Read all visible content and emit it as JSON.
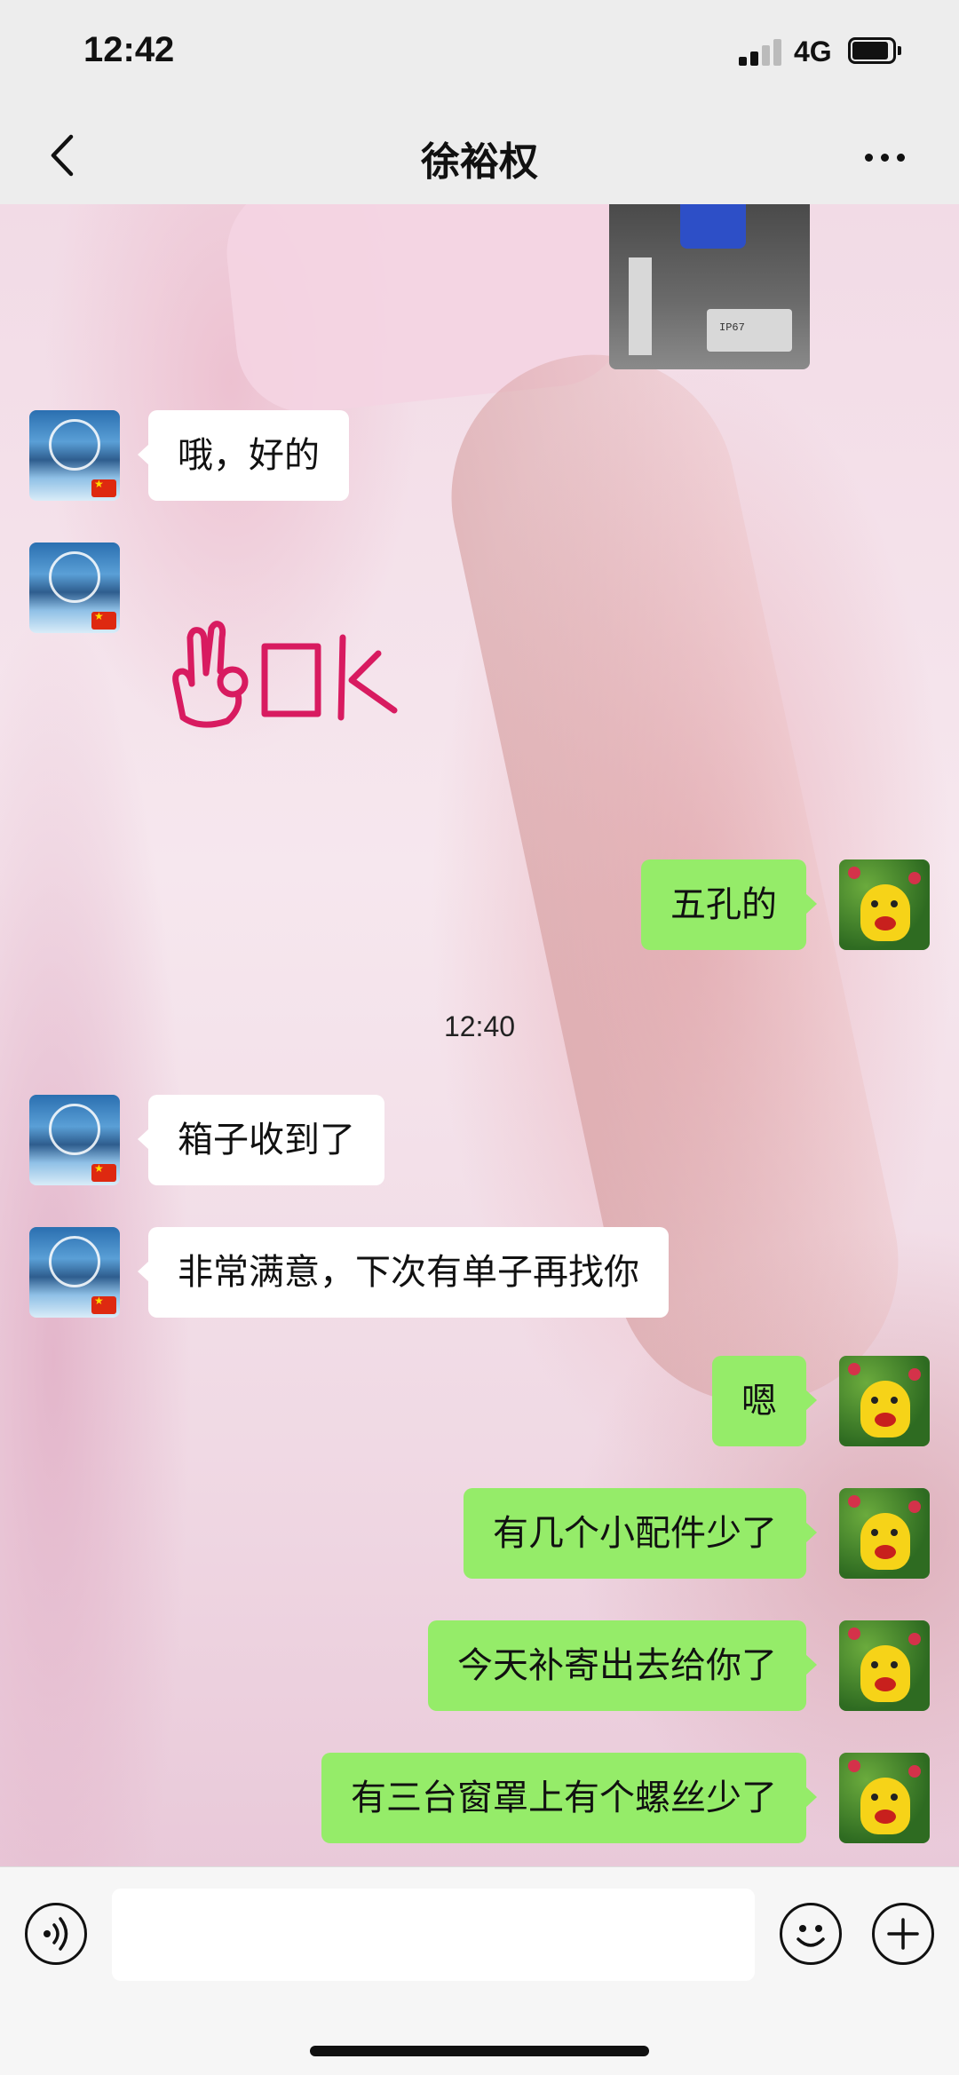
{
  "status_bar": {
    "time": "12:42",
    "network": "4G",
    "battery_level": 0.85
  },
  "nav": {
    "title": "徐裕权",
    "back_icon": "chevron-left-icon",
    "more_icon": "more-horizontal-icon"
  },
  "messages": [
    {
      "sender": "contact",
      "type": "image"
    },
    {
      "sender": "contact",
      "type": "text",
      "text": "哦，好的"
    },
    {
      "sender": "contact",
      "type": "sticker",
      "sticker": "ok-hand-sticker"
    },
    {
      "sender": "self",
      "type": "text",
      "text": "五孔的"
    },
    {
      "type": "timestamp",
      "text": "12:40"
    },
    {
      "sender": "contact",
      "type": "text",
      "text": "箱子收到了"
    },
    {
      "sender": "contact",
      "type": "text",
      "text": "非常满意，下次有单子再找你"
    },
    {
      "sender": "self",
      "type": "text",
      "text": "嗯"
    },
    {
      "sender": "self",
      "type": "text",
      "text": "有几个小配件少了"
    },
    {
      "sender": "self",
      "type": "text",
      "text": "今天补寄出去给你了"
    },
    {
      "sender": "self",
      "type": "text",
      "text": "有三台窗罩上有个螺丝少了"
    }
  ],
  "input_bar": {
    "voice_icon": "voice-icon",
    "emoji_icon": "emoji-icon",
    "add_icon": "plus-circle-icon",
    "placeholder": ""
  },
  "colors": {
    "bubble_self": "#95ec69",
    "bubble_contact": "#ffffff",
    "bar_background": "#ededed",
    "ok_sticker": "#d81b60"
  }
}
